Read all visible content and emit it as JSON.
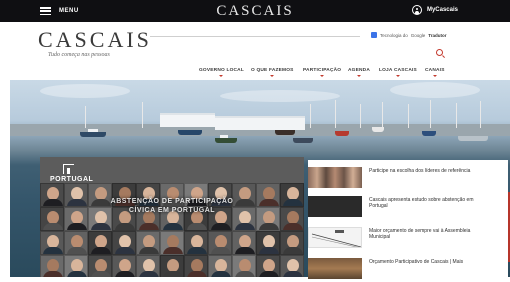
{
  "topbar": {
    "menu_label": "MENU",
    "logo": "CASCAIS",
    "account_label": "MyCascais"
  },
  "header": {
    "brand": "CASCAIS",
    "tagline": "Tudo começa nas pessoas",
    "translate_prefix": "Tecnologia do",
    "translate_google": "Google",
    "translate_label": "Tradutor"
  },
  "nav": {
    "items": [
      "GOVERNO LOCAL",
      "O QUE FAZEMOS",
      "PARTICIPAÇÃO",
      "AGENDA",
      "LOJA CASCAIS",
      "CANAIS"
    ]
  },
  "feature": {
    "brand": "PORTUGAL",
    "title_line1": "ABSTENÇÃO DE PARTICIPAÇÃO",
    "title_line2": "CÍVICA EM PORTUGAL"
  },
  "news": [
    {
      "text": "Participe na escolha dos líderes de referência"
    },
    {
      "text": "Cascais apresenta estudo sobre abstenção em Portugal"
    },
    {
      "text": "Maior orçamento de sempre vai à Assembleia Municipal"
    },
    {
      "text": "Orçamento Participativo de Cascais | Mais"
    }
  ],
  "colors": {
    "topbar": "#0f0f12",
    "accent": "#c43a2e",
    "brand_text": "#3a3a3a"
  }
}
